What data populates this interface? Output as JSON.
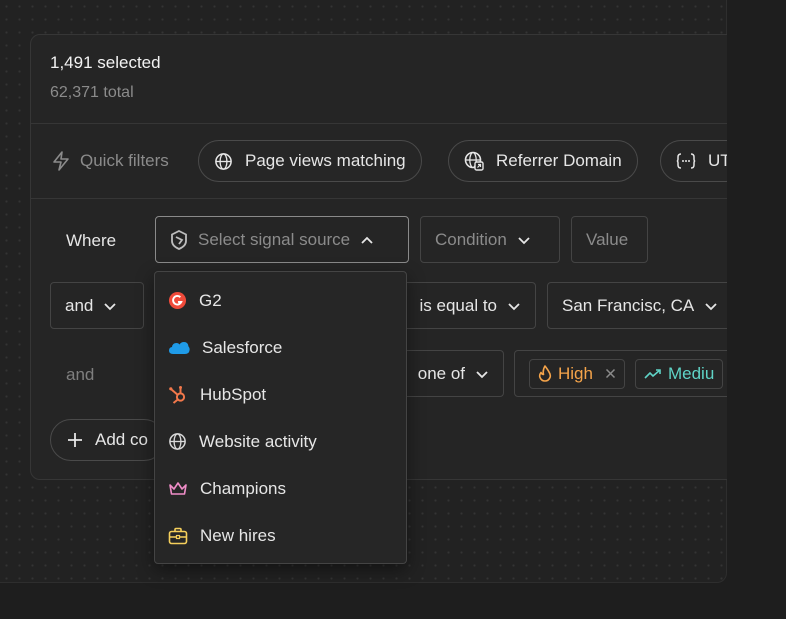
{
  "summary": {
    "selected": "1,491 selected",
    "total": "62,371 total"
  },
  "quick_filters": {
    "label": "Quick filters",
    "chips": [
      {
        "label": "Page views matching",
        "icon": "globe-icon"
      },
      {
        "label": "Referrer Domain",
        "icon": "globe-link-icon"
      },
      {
        "label": "UT",
        "icon": "braces-icon"
      }
    ]
  },
  "conditions": {
    "row1": {
      "prefix": "Where",
      "source_placeholder": "Select signal source",
      "condition_placeholder": "Condition",
      "value_placeholder": "Value"
    },
    "row2": {
      "prefix": "and",
      "operator": "is equal to",
      "value": "San Francisc, CA"
    },
    "row3": {
      "prefix": "and",
      "operator": "one of",
      "tags": [
        "High",
        "Mediu"
      ]
    },
    "add_label": "Add co"
  },
  "dropdown": {
    "items": [
      {
        "label": "G2",
        "icon": "g2-icon",
        "color": "#ef4a3a"
      },
      {
        "label": "Salesforce",
        "icon": "salesforce-cloud-icon",
        "color": "#1f9be8"
      },
      {
        "label": "HubSpot",
        "icon": "hubspot-icon",
        "color": "#f2784b"
      },
      {
        "label": "Website activity",
        "icon": "globe-icon",
        "color": "#d8d8d8"
      },
      {
        "label": "Champions",
        "icon": "crown-icon",
        "color": "#f08dc8"
      },
      {
        "label": "New hires",
        "icon": "briefcase-icon",
        "color": "#f5cf5b"
      }
    ]
  },
  "colors": {
    "high": "#f5a44a",
    "medium": "#5fd3c6"
  }
}
